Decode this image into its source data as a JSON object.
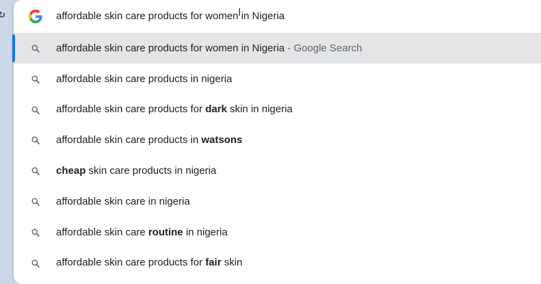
{
  "omnibox": {
    "query": "affordable skin care products for women in Nigeria",
    "engine_icon": "google-g-icon"
  },
  "suggestions": [
    {
      "icon": "search-icon",
      "parts": [
        {
          "text": "affordable skin care products for women in Nigeria",
          "bold": false
        },
        {
          "text": " - Google Search",
          "suffix": true
        }
      ],
      "selected": true
    },
    {
      "icon": "search-icon",
      "parts": [
        {
          "text": "affordable skin care products in nigeria",
          "bold": false
        }
      ],
      "selected": false
    },
    {
      "icon": "search-icon",
      "parts": [
        {
          "text": "affordable skin care products for ",
          "bold": false
        },
        {
          "text": "dark",
          "bold": true
        },
        {
          "text": " skin in nigeria",
          "bold": false
        }
      ],
      "selected": false
    },
    {
      "icon": "search-icon",
      "parts": [
        {
          "text": "affordable skin care products in ",
          "bold": false
        },
        {
          "text": "watsons",
          "bold": true
        }
      ],
      "selected": false
    },
    {
      "icon": "search-icon",
      "parts": [
        {
          "text": "cheap",
          "bold": true
        },
        {
          "text": " skin care products in nigeria",
          "bold": false
        }
      ],
      "selected": false
    },
    {
      "icon": "search-icon",
      "parts": [
        {
          "text": "affordable skin care in nigeria",
          "bold": false
        }
      ],
      "selected": false
    },
    {
      "icon": "search-icon",
      "parts": [
        {
          "text": "affordable skin care ",
          "bold": false
        },
        {
          "text": "routine",
          "bold": true
        },
        {
          "text": " in nigeria",
          "bold": false
        }
      ],
      "selected": false
    },
    {
      "icon": "search-icon",
      "parts": [
        {
          "text": "affordable skin care products for ",
          "bold": false
        },
        {
          "text": "fair",
          "bold": true
        },
        {
          "text": " skin",
          "bold": false
        }
      ],
      "selected": false
    }
  ],
  "colors": {
    "selected_row": "#e4e5e7",
    "selection_indicator": "#1a73e8",
    "text": "#202124",
    "secondary_text": "#5f6368"
  }
}
